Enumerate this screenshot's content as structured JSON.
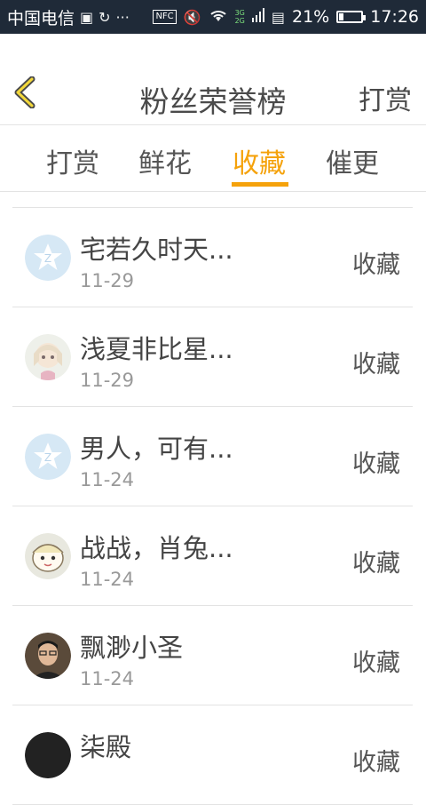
{
  "status_bar": {
    "carrier": "中国电信",
    "battery": "21%",
    "battery_level": 0.21,
    "time": "17:26",
    "network_top": "3G",
    "network_bottom": "2G",
    "nfc": "NFC"
  },
  "header": {
    "title": "粉丝荣誉榜",
    "action": "打赏"
  },
  "tabs": [
    {
      "label": "打赏"
    },
    {
      "label": "鲜花"
    },
    {
      "label": "收藏",
      "active": true
    },
    {
      "label": "催更"
    }
  ],
  "colors": {
    "accent": "#f5a20b",
    "status_bar": "#1f2a38"
  },
  "list": [
    {
      "name": "宅若久时天...",
      "date": "11-29",
      "status": "收藏",
      "avatar": "default-star-avatar"
    },
    {
      "name": "浅夏非比星...",
      "date": "11-29",
      "status": "收藏",
      "avatar": "anime-girl-avatar"
    },
    {
      "name": "男人，可有...",
      "date": "11-24",
      "status": "收藏",
      "avatar": "default-star-avatar"
    },
    {
      "name": "战战，肖兔...",
      "date": "11-24",
      "status": "收藏",
      "avatar": "cartoon-avatar"
    },
    {
      "name": "飘渺小圣",
      "date": "11-24",
      "status": "收藏",
      "avatar": "photo-avatar"
    },
    {
      "name": "柒殿",
      "date": "",
      "status": "收藏",
      "avatar": "dark-avatar"
    }
  ]
}
